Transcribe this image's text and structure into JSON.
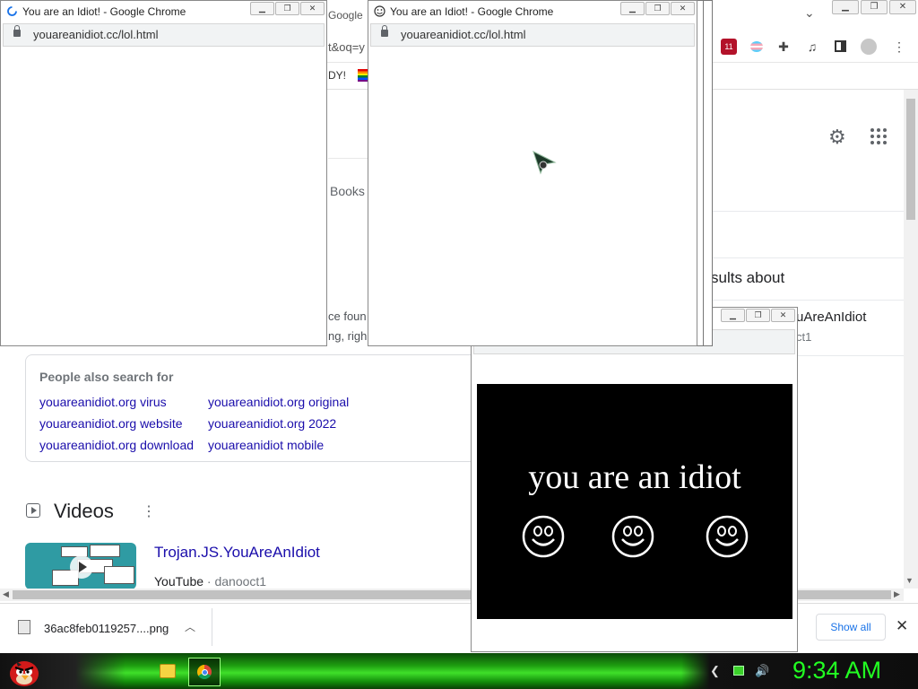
{
  "background_browser": {
    "tab_label": "Google",
    "url_fragment": "t&oq=y",
    "bookmark_fragment": "DY!",
    "extension_badge": "11",
    "books_tab": "Books",
    "results_about": "sults about",
    "snippet_line1": "ce foun",
    "snippet_line2": "ng, righ",
    "right_panel_title": "uAreAnIdiot",
    "right_panel_sub": "ct1",
    "people_also_search": {
      "title": "People also search for",
      "links": [
        "youareanidiot.org virus",
        "youareanidiot.org original",
        "youareanidiot.org website",
        "youareanidiot.org 2022",
        "youareanidiot.org download",
        "youareanidiot mobile"
      ]
    },
    "videos": {
      "heading": "Videos",
      "result_title": "Trojan.JS.YouAreAnIdiot",
      "source": "YouTube",
      "channel": "danooct1"
    }
  },
  "download_shelf": {
    "file_name": "36ac8feb0119257....png",
    "show_all": "Show all"
  },
  "popups": {
    "left": {
      "title": "You are an Idiot! - Google Chrome",
      "url": "youareanidiot.cc/lol.html"
    },
    "middle": {
      "title": "You are an Idiot! - Google Chrome",
      "url": "youareanidiot.cc/lol.html"
    },
    "bottom": {
      "message": "you are an idiot"
    }
  },
  "taskbar": {
    "clock": "9:34 AM"
  },
  "colors": {
    "link": "#1a0dab",
    "taskbar_green": "#3fe02a",
    "clock_green": "#22ff22"
  },
  "icons": [
    "angry-bird-start-icon",
    "folder-icon",
    "chrome-icon",
    "gear-icon",
    "apps-grid-icon",
    "puzzle-icon",
    "lock-icon",
    "smiley-icon",
    "speaker-icon",
    "network-icon"
  ]
}
